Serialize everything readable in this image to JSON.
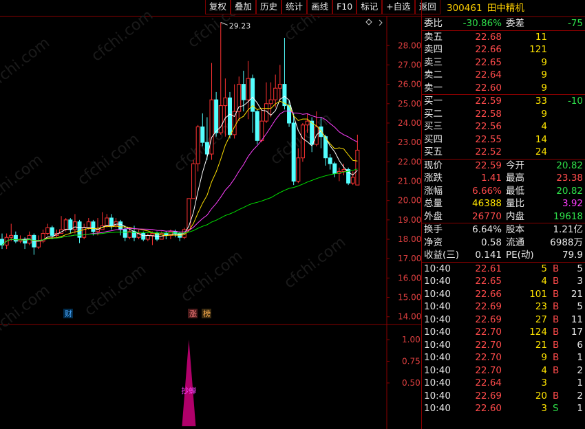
{
  "toolbar": {
    "buttons": [
      "复权",
      "叠加",
      "历史",
      "统计",
      "画线",
      "F10",
      "标记",
      "+自选",
      "返回"
    ]
  },
  "stock": {
    "code": "300461",
    "name": "田中精机"
  },
  "ratio": {
    "wb_label": "委比",
    "wb_value": "-30.86%",
    "wc_label": "委差",
    "wc_value": "-75"
  },
  "sell_orders": [
    {
      "label": "卖五",
      "price": "22.68",
      "vol": "11"
    },
    {
      "label": "卖四",
      "price": "22.66",
      "vol": "121"
    },
    {
      "label": "卖三",
      "price": "22.65",
      "vol": "9"
    },
    {
      "label": "卖二",
      "price": "22.64",
      "vol": "9"
    },
    {
      "label": "卖一",
      "price": "22.60",
      "vol": "9"
    }
  ],
  "buy_orders": [
    {
      "label": "买一",
      "price": "22.59",
      "vol": "33",
      "chg": "-10"
    },
    {
      "label": "买二",
      "price": "22.58",
      "vol": "9",
      "chg": ""
    },
    {
      "label": "买三",
      "price": "22.56",
      "vol": "4",
      "chg": ""
    },
    {
      "label": "买四",
      "price": "22.55",
      "vol": "14",
      "chg": ""
    },
    {
      "label": "买五",
      "price": "22.52",
      "vol": "24",
      "chg": ""
    }
  ],
  "quote": [
    {
      "l1": "现价",
      "v1": "22.59",
      "l2": "今开",
      "v2": "20.82"
    },
    {
      "l1": "涨跌",
      "v1": "1.41",
      "l2": "最高",
      "v2": "23.38"
    },
    {
      "l1": "涨幅",
      "v1": "6.66%",
      "l2": "最低",
      "v2": "20.82"
    },
    {
      "l1": "总量",
      "v1": "46388",
      "l2": "量比",
      "v2": "3.92"
    },
    {
      "l1": "外盘",
      "v1": "26770",
      "l2": "内盘",
      "v2": "19618"
    }
  ],
  "finance": [
    {
      "l1": "换手",
      "v1": "6.64%",
      "l2": "股本",
      "v2": "1.21亿"
    },
    {
      "l1": "净资",
      "v1": "0.58",
      "l2": "流通",
      "v2": "6988万"
    },
    {
      "l1": "收益(三)",
      "v1": "0.141",
      "l2": "PE(动)",
      "v2": "79.9"
    }
  ],
  "ticks": [
    {
      "time": "10:40",
      "price": "22.61",
      "vol": "5",
      "bs": "B",
      "n": "5"
    },
    {
      "time": "10:40",
      "price": "22.65",
      "vol": "4",
      "bs": "B",
      "n": "3"
    },
    {
      "time": "10:40",
      "price": "22.66",
      "vol": "101",
      "bs": "B",
      "n": "21"
    },
    {
      "time": "10:40",
      "price": "22.69",
      "vol": "23",
      "bs": "B",
      "n": "5"
    },
    {
      "time": "10:40",
      "price": "22.69",
      "vol": "27",
      "bs": "B",
      "n": "11"
    },
    {
      "time": "10:40",
      "price": "22.70",
      "vol": "124",
      "bs": "B",
      "n": "17"
    },
    {
      "time": "10:40",
      "price": "22.70",
      "vol": "21",
      "bs": "B",
      "n": "6"
    },
    {
      "time": "10:40",
      "price": "22.70",
      "vol": "9",
      "bs": "B",
      "n": "1"
    },
    {
      "time": "10:40",
      "price": "22.70",
      "vol": "4",
      "bs": "B",
      "n": "2"
    },
    {
      "time": "10:40",
      "price": "22.64",
      "vol": "3",
      "bs": "",
      "n": "1"
    },
    {
      "time": "10:40",
      "price": "22.69",
      "vol": "20",
      "bs": "B",
      "n": "2"
    },
    {
      "time": "10:40",
      "price": "22.60",
      "vol": "3",
      "bs": "S",
      "n": "1"
    }
  ],
  "chart": {
    "high_label": "29.23",
    "price_axis": [
      "28.00",
      "27.00",
      "26.00",
      "25.00",
      "24.00",
      "23.00",
      "22.00",
      "21.00",
      "20.00",
      "19.00",
      "18.00",
      "17.00",
      "16.00",
      "15.00",
      "14.00"
    ],
    "ind_axis": [
      "1.00",
      "0.75",
      "0.50"
    ],
    "markers": {
      "cai": "财",
      "zhang": "涨",
      "bang": "榜"
    },
    "indicator_label": "抄蝉",
    "watermark": "cfchi.com"
  },
  "chart_data": {
    "type": "candlestick",
    "ylim": [
      13.6,
      29.5
    ],
    "candles": [
      [
        18.0,
        17.7,
        18.3,
        17.5
      ],
      [
        17.7,
        18.1,
        18.3,
        17.5
      ],
      [
        18.1,
        18.2,
        18.8,
        17.9
      ],
      [
        18.2,
        17.9,
        18.4,
        17.8
      ],
      [
        17.9,
        18.0,
        18.2,
        17.8
      ],
      [
        18.0,
        17.8,
        18.1,
        17.5
      ],
      [
        17.8,
        18.2,
        18.4,
        17.7
      ],
      [
        18.2,
        17.6,
        18.3,
        17.2
      ],
      [
        17.6,
        17.9,
        18.2,
        17.5
      ],
      [
        17.9,
        18.3,
        18.5,
        17.8
      ],
      [
        18.3,
        18.6,
        18.8,
        18.2
      ],
      [
        18.6,
        18.2,
        18.7,
        18.0
      ],
      [
        18.2,
        18.3,
        18.5,
        18.1
      ],
      [
        18.3,
        18.5,
        19.2,
        18.3
      ],
      [
        18.5,
        19.0,
        19.1,
        18.4
      ],
      [
        19.0,
        18.5,
        19.1,
        18.3
      ],
      [
        18.5,
        18.9,
        19.3,
        18.3
      ],
      [
        18.9,
        18.1,
        19.0,
        17.8
      ],
      [
        18.1,
        18.6,
        18.8,
        18.0
      ],
      [
        18.6,
        18.9,
        19.1,
        18.5
      ],
      [
        18.9,
        18.4,
        19.0,
        18.2
      ],
      [
        18.4,
        18.5,
        19.1,
        18.2
      ],
      [
        18.5,
        18.7,
        19.4,
        18.5
      ],
      [
        18.7,
        19.1,
        19.3,
        18.6
      ],
      [
        19.1,
        18.7,
        19.3,
        18.5
      ],
      [
        18.7,
        18.9,
        19.1,
        18.6
      ],
      [
        18.9,
        18.5,
        19.0,
        18.2
      ],
      [
        18.5,
        18.1,
        18.7,
        17.9
      ],
      [
        18.1,
        18.4,
        18.6,
        18.0
      ],
      [
        18.4,
        18.1,
        18.7,
        17.9
      ],
      [
        18.1,
        18.3,
        18.5,
        18.0
      ],
      [
        18.3,
        18.0,
        18.4,
        17.9
      ],
      [
        18.0,
        18.2,
        18.3,
        17.9
      ],
      [
        18.2,
        18.3,
        18.4,
        17.7
      ],
      [
        18.3,
        18.0,
        18.4,
        17.9
      ],
      [
        18.0,
        18.3,
        18.4,
        18.0
      ],
      [
        18.3,
        18.2,
        18.4,
        18.0
      ],
      [
        18.2,
        18.4,
        18.5,
        18.0
      ],
      [
        18.4,
        18.3,
        18.5,
        18.1
      ],
      [
        18.3,
        18.1,
        18.4,
        17.9
      ],
      [
        18.1,
        18.5,
        18.6,
        18.0
      ],
      [
        18.5,
        20.1,
        20.1,
        18.5
      ],
      [
        20.1,
        21.9,
        22.1,
        20.3
      ],
      [
        21.9,
        23.8,
        23.9,
        21.5
      ],
      [
        23.8,
        23.0,
        24.5,
        22.8
      ],
      [
        23.0,
        22.4,
        24.3,
        22.1
      ],
      [
        22.4,
        25.2,
        27.1,
        22.1
      ],
      [
        25.2,
        23.5,
        25.6,
        23.3
      ],
      [
        23.5,
        24.9,
        29.2,
        23.4
      ],
      [
        24.9,
        25.3,
        26.3,
        23.3
      ],
      [
        25.3,
        23.4,
        25.6,
        23.2
      ],
      [
        23.4,
        24.6,
        26.0,
        23.2
      ],
      [
        24.6,
        26.0,
        26.4,
        24.1
      ],
      [
        26.0,
        25.2,
        26.7,
        24.6
      ],
      [
        25.2,
        26.3,
        27.2,
        24.2
      ],
      [
        26.3,
        24.6,
        26.5,
        23.5
      ],
      [
        24.6,
        23.1,
        24.7,
        22.9
      ],
      [
        23.1,
        24.1,
        24.7,
        23.0
      ],
      [
        24.1,
        25.0,
        26.1,
        24.0
      ],
      [
        25.0,
        25.2,
        26.1,
        24.3
      ],
      [
        25.2,
        25.8,
        26.5,
        24.8
      ],
      [
        25.8,
        26.0,
        27.0,
        25.2
      ],
      [
        26.0,
        24.9,
        28.4,
        24.7
      ],
      [
        24.9,
        24.0,
        25.2,
        23.8
      ],
      [
        24.0,
        21.0,
        24.5,
        20.8
      ],
      [
        21.0,
        22.2,
        22.7,
        20.9
      ],
      [
        22.2,
        23.9,
        24.0,
        22.0
      ],
      [
        23.9,
        24.1,
        24.5,
        23.5
      ],
      [
        24.1,
        22.9,
        24.3,
        22.5
      ],
      [
        22.9,
        23.8,
        24.6,
        22.8
      ],
      [
        23.8,
        23.3,
        24.3,
        22.7
      ],
      [
        23.3,
        22.2,
        23.4,
        21.8
      ],
      [
        22.2,
        21.9,
        22.4,
        21.6
      ],
      [
        21.9,
        21.4,
        22.0,
        21.2
      ],
      [
        21.4,
        21.5,
        21.7,
        21.0
      ],
      [
        21.5,
        21.6,
        21.9,
        21.3
      ],
      [
        21.6,
        20.9,
        21.7,
        20.8
      ],
      [
        20.9,
        21.2,
        21.5,
        20.8
      ],
      [
        20.8,
        22.6,
        23.4,
        20.8
      ]
    ],
    "volume_markers": [
      0,
      0,
      0,
      0,
      0,
      0,
      0,
      0,
      0,
      0,
      0,
      0,
      0,
      0,
      0,
      0,
      0,
      0,
      0,
      0,
      0,
      0,
      0,
      0,
      0,
      0,
      0,
      0,
      0,
      0,
      0,
      0,
      0,
      0,
      0,
      0,
      0,
      0,
      0,
      0,
      0,
      1,
      0,
      0,
      0,
      0,
      0,
      0,
      0,
      0,
      0,
      0,
      0,
      0,
      0,
      0,
      0,
      0,
      0,
      0,
      0,
      0,
      0,
      0,
      0,
      0,
      0,
      0,
      0,
      0,
      0,
      0,
      0,
      0,
      0,
      0,
      0,
      0,
      0
    ],
    "colors": {
      "up": "#ff3232",
      "down": "#54ffff",
      "ma5": "#ffffff",
      "ma10": "#ffe000",
      "ma20": "#ff40ff",
      "ma60": "#00e000",
      "indicator": "#b0006a"
    }
  }
}
